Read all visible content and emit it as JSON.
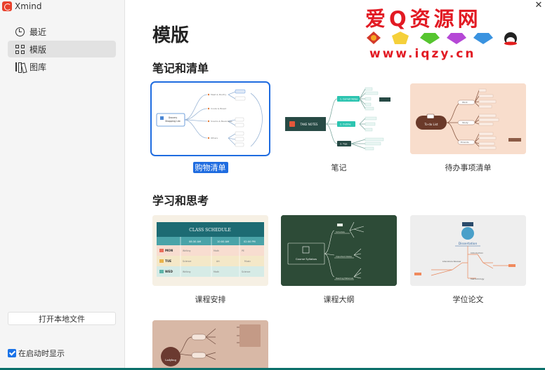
{
  "titlebar": {
    "app_name": "Xmind"
  },
  "sidebar": {
    "items": [
      {
        "label": "最近",
        "icon": "clock-icon",
        "active": false
      },
      {
        "label": "模版",
        "icon": "grid-icon",
        "active": true
      },
      {
        "label": "图库",
        "icon": "library-icon",
        "active": false
      }
    ],
    "open_file_label": "打开本地文件",
    "show_on_startup_label": "在启动时显示",
    "show_on_startup_checked": true
  },
  "main": {
    "title": "模版",
    "sections": [
      {
        "title": "笔记和清单",
        "templates": [
          {
            "label": "购物清单",
            "selected": true
          },
          {
            "label": "笔记",
            "selected": false
          },
          {
            "label": "待办事项清单",
            "selected": false
          }
        ]
      },
      {
        "title": "学习和思考",
        "templates": [
          {
            "label": "课程安排",
            "selected": false
          },
          {
            "label": "课程大纲",
            "selected": false
          },
          {
            "label": "学位论文",
            "selected": false
          }
        ]
      }
    ],
    "thumb_text": {
      "shopping_center": "Grocery Shopping List",
      "notes_center": "TAKE NOTES",
      "todo_center": "To-do List",
      "schedule_title": "CLASS SCHEDULE",
      "schedule_times": [
        "08:30 AM",
        "10:00 AM",
        "02:00 PM"
      ],
      "schedule_rows": [
        {
          "day": "MON",
          "cells": [
            "Writing",
            "Math",
            "PE"
          ]
        },
        {
          "day": "TUE",
          "cells": [
            "Science",
            "Art",
            "Music"
          ]
        },
        {
          "day": "WED",
          "cells": [
            "Writing",
            "Math",
            "Science"
          ]
        }
      ],
      "syllabus_center": "Course Syllabus",
      "thesis_center": "Dissertation",
      "thesis_nodes": [
        "Introduction",
        "Literature Review",
        "Methodology"
      ],
      "ladybug_center": "Ladybug"
    }
  },
  "watermark": {
    "title": "爱Q资源网",
    "url": "www.iqzy.cn"
  },
  "colors": {
    "accent": "#1f6ce0",
    "selected_bg": "#e2e2e2",
    "watermark": "#e21a23"
  }
}
